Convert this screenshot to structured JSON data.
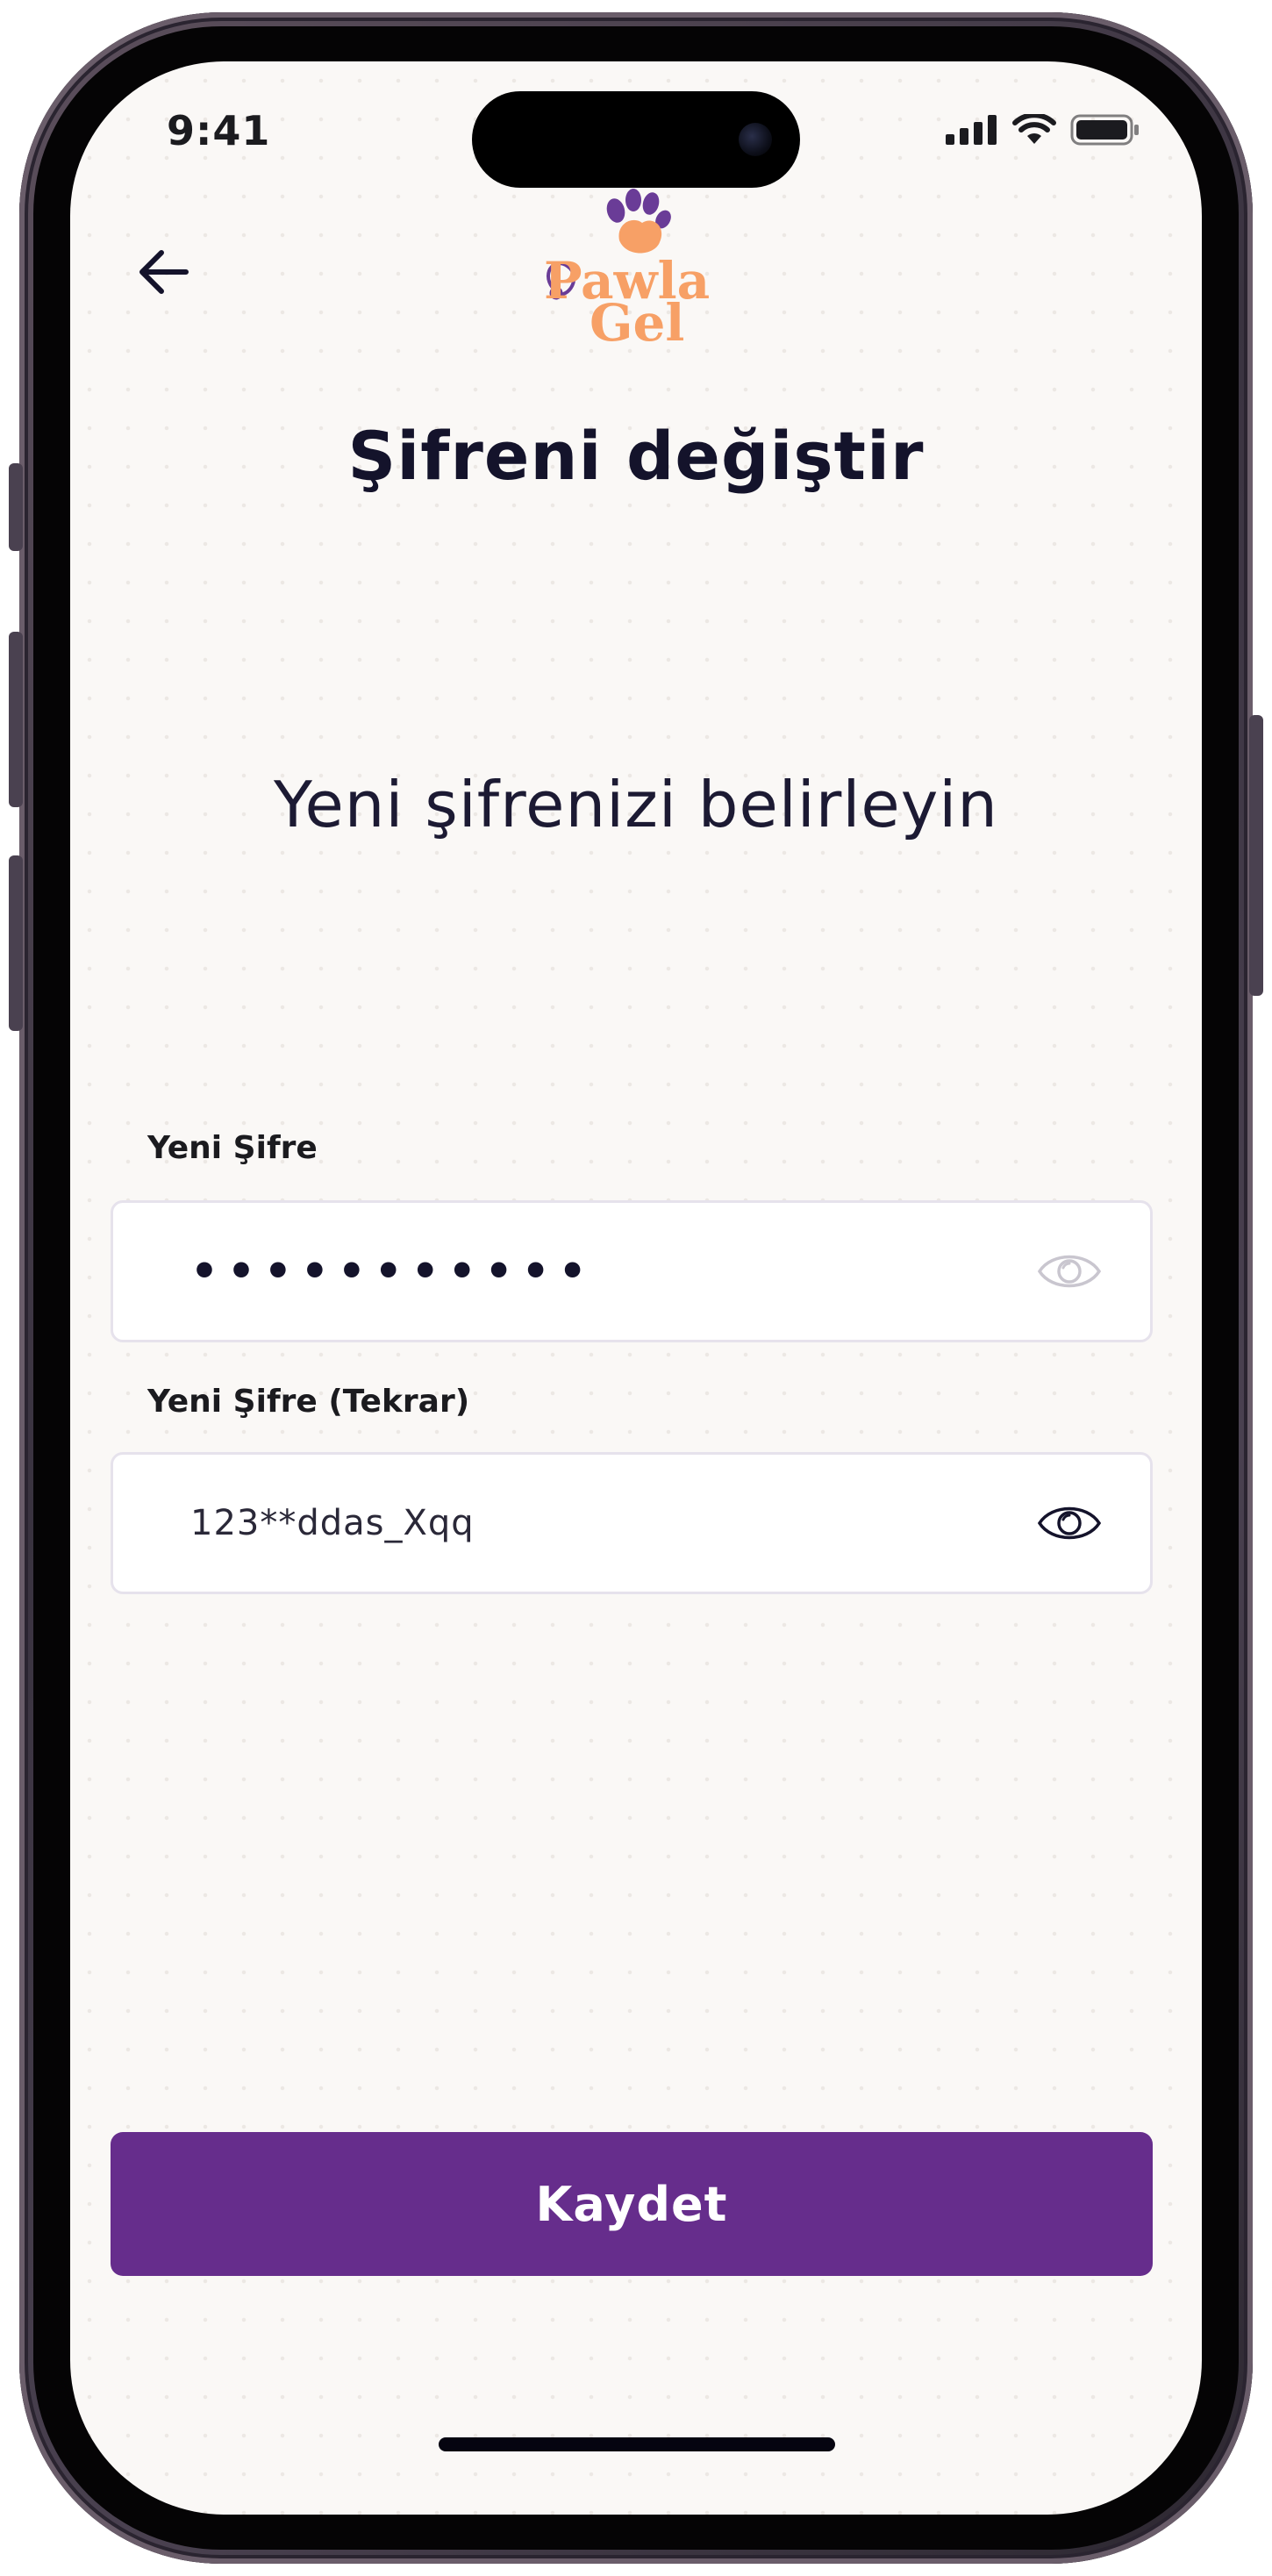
{
  "status_bar": {
    "time": "9:41"
  },
  "header": {
    "logo": {
      "line1": "Pawla",
      "line2": "Gel"
    }
  },
  "page": {
    "title": "Şifreni değiştir",
    "subtitle": "Yeni şifrenizi belirleyin"
  },
  "form": {
    "new_password": {
      "label": "Yeni Şifre",
      "value": "•••••••••••"
    },
    "repeat_password": {
      "label": "Yeni Şifre (Tekrar)",
      "value": "123**ddas_Xqq"
    }
  },
  "actions": {
    "save_label": "Kaydet"
  },
  "colors": {
    "primary": "#662d8c",
    "logo_orange": "#f7a066",
    "logo_purple": "#6a3c97",
    "background": "#faf8f6",
    "text_dark": "#14132b",
    "field_border": "#e6e2ec"
  },
  "icons": {
    "back": "arrow-left-icon",
    "eye_new": "eye-icon",
    "eye_repeat": "eye-icon",
    "signal": "cellular-signal-icon",
    "wifi": "wifi-icon",
    "battery": "battery-icon"
  }
}
